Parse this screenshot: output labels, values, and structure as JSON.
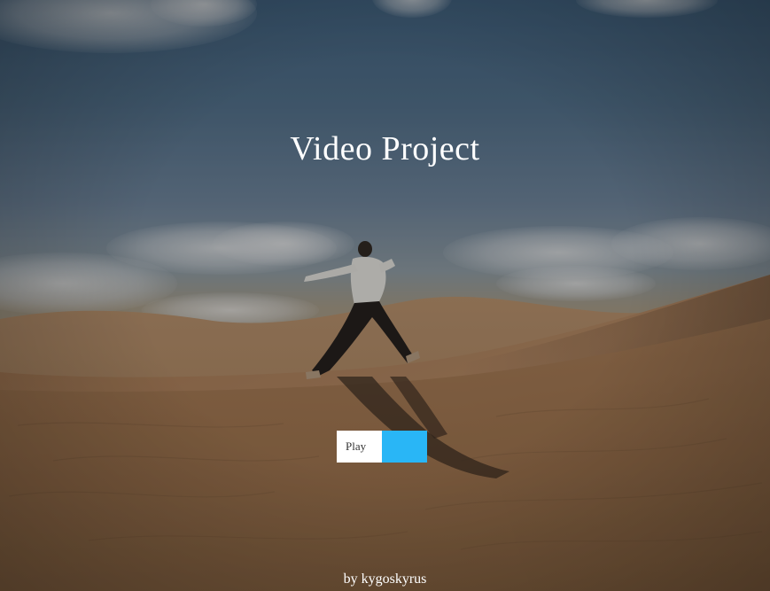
{
  "hero": {
    "title": "Video Project",
    "play_label": "Play",
    "author": "by kygoskyrus"
  },
  "colors": {
    "accent": "#29b6f6",
    "title_text": "#ffffff",
    "button_bg": "#ffffff"
  }
}
